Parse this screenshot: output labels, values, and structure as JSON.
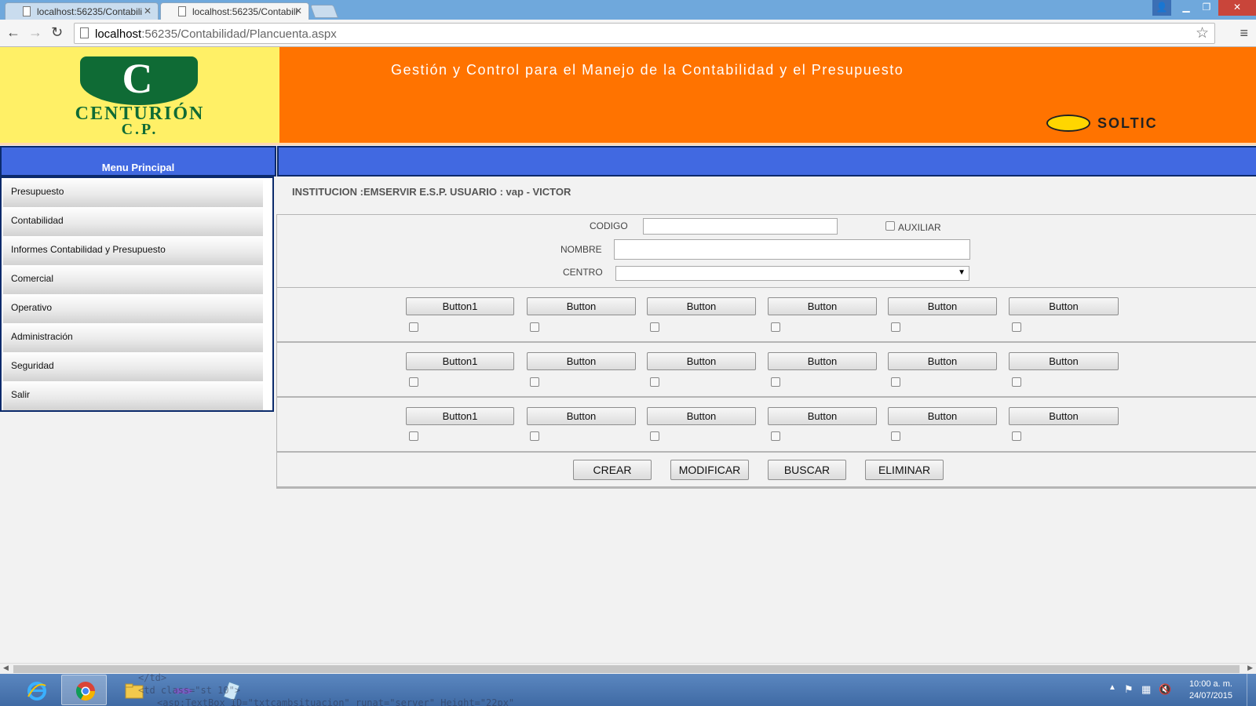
{
  "browser": {
    "tabs": [
      {
        "title": "localhost:56235/Contabili",
        "active": false
      },
      {
        "title": "localhost:56235/Contabili",
        "active": true
      }
    ],
    "url_host": "localhost",
    "url_rest": ":56235/Contabilidad/Plancuenta.aspx"
  },
  "header": {
    "logo_top": "C",
    "logo_name": "CENTURIÓN",
    "logo_sub": "C.P.",
    "title": "Gestión y Control para el Manejo de la Contabilidad y el Presupuesto",
    "brand": "SOLTIC"
  },
  "sidebar": {
    "title": "Menu Principal",
    "items": [
      {
        "label": "Presupuesto"
      },
      {
        "label": "Contabilidad"
      },
      {
        "label": "Informes Contabilidad y Presupuesto"
      },
      {
        "label": "Comercial"
      },
      {
        "label": "Operativo"
      },
      {
        "label": "Administración"
      },
      {
        "label": "Seguridad"
      },
      {
        "label": "Salir"
      }
    ]
  },
  "main": {
    "info": "INSTITUCION :EMSERVIR E.S.P. USUARIO : vap - VICTOR",
    "form": {
      "codigo_label": "CODIGO",
      "codigo_value": "",
      "auxiliar_label": "AUXILIAR",
      "nombre_label": "NOMBRE",
      "nombre_value": "",
      "centro_label": "CENTRO",
      "centro_value": ""
    },
    "button_rows": [
      {
        "buttons": [
          "Button1",
          "Button",
          "Button",
          "Button",
          "Button",
          "Button"
        ]
      },
      {
        "buttons": [
          "Button1",
          "Button",
          "Button",
          "Button",
          "Button",
          "Button"
        ]
      },
      {
        "buttons": [
          "Button1",
          "Button",
          "Button",
          "Button",
          "Button",
          "Button"
        ]
      }
    ],
    "actions": {
      "crear": "CREAR",
      "modificar": "MODIFICAR",
      "buscar": "BUSCAR",
      "eliminar": "ELIMINAR"
    }
  },
  "taskbar": {
    "ghost_line1": "</td>",
    "ghost_line2": "<td class=\"st 10\">",
    "ghost_line3": "<asp:TextBox ID=\"txtcambsituacion\" runat=\"server\" Height=\"22px\"",
    "clock_time": "10:00 a. m.",
    "clock_date": "24/07/2015"
  },
  "colors": {
    "header_yellow": "#fff066",
    "header_orange": "#ff7300",
    "menu_blue": "#4169e1",
    "logo_green": "#0f6b35"
  }
}
